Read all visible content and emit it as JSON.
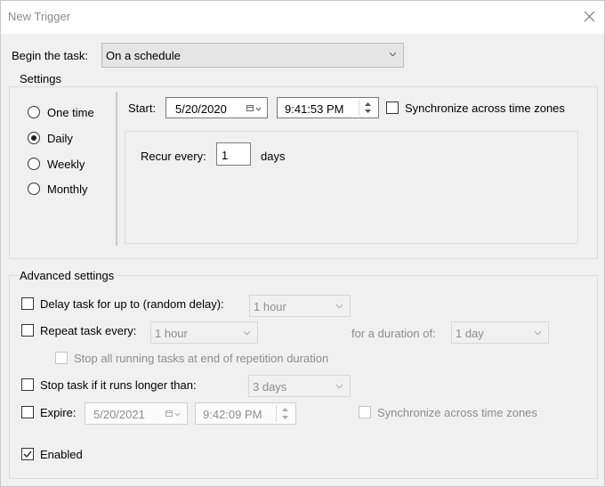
{
  "window": {
    "title": "New Trigger"
  },
  "begin": {
    "label": "Begin the task:",
    "value": "On a schedule"
  },
  "settings": {
    "label": "Settings",
    "options": [
      "One time",
      "Daily",
      "Weekly",
      "Monthly"
    ],
    "selected_index": 1,
    "start_label": "Start:",
    "start_date": "5/20/2020",
    "start_time": "9:41:53 PM",
    "sync_label": "Synchronize across time zones",
    "recur_label": "Recur every:",
    "recur_value": "1",
    "recur_unit": "days"
  },
  "advanced": {
    "label": "Advanced settings",
    "delay_label": "Delay task for up to (random delay):",
    "delay_value": "1 hour",
    "repeat_label": "Repeat task every:",
    "repeat_value": "1 hour",
    "duration_label": "for a duration of:",
    "duration_value": "1 day",
    "stop_all_label": "Stop all running tasks at end of repetition duration",
    "stop_long_label": "Stop task if it runs longer than:",
    "stop_long_value": "3 days",
    "expire_label": "Expire:",
    "expire_date": "5/20/2021",
    "expire_time": "9:42:09 PM",
    "expire_sync_label": "Synchronize across time zones",
    "enabled_label": "Enabled"
  },
  "colors": {
    "background": "#f0f0f0",
    "disabled_text": "#8d8d8d",
    "combo_bg": "#e5e5e5"
  }
}
